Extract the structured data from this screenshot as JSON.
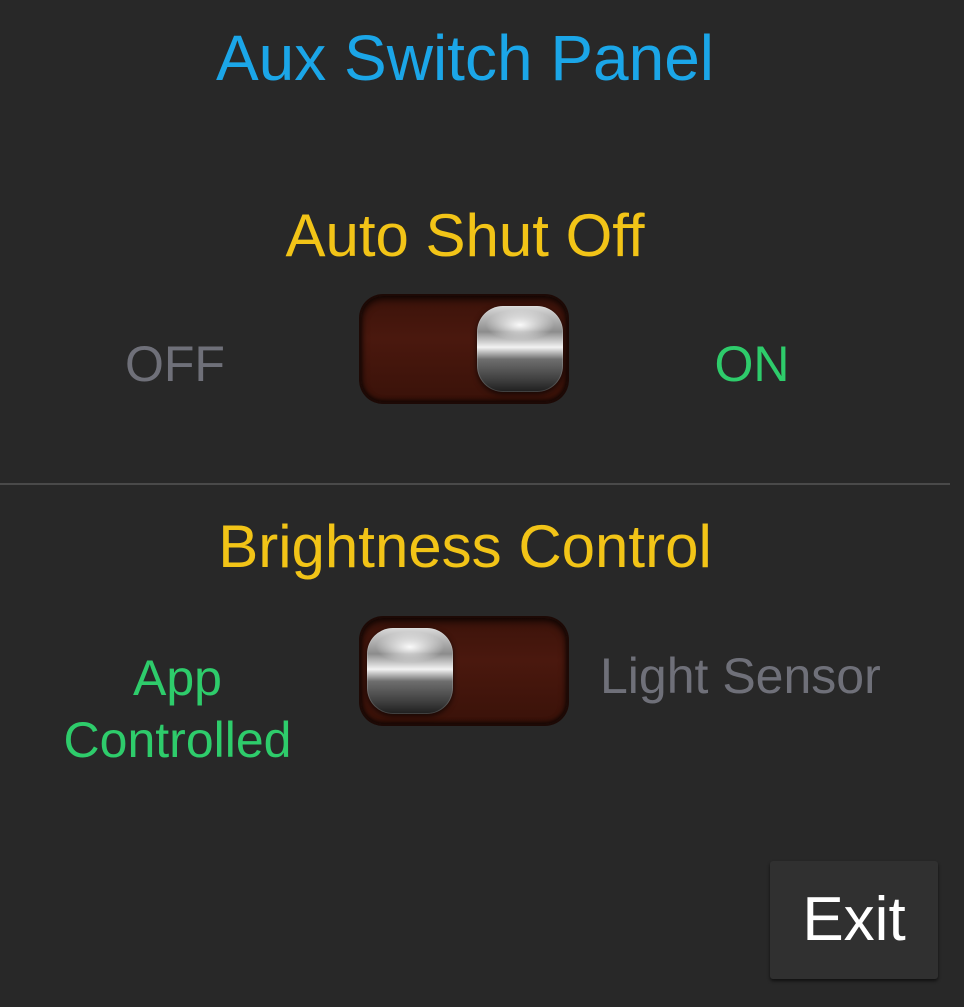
{
  "panel": {
    "title": "Aux Switch Panel",
    "accent_color": "#1ba6e8"
  },
  "auto_shut_off": {
    "title": "Auto Shut Off",
    "off_label": "OFF",
    "on_label": "ON",
    "state": "on"
  },
  "brightness_control": {
    "title": "Brightness Control",
    "left_label_line1": "App",
    "left_label_line2": "Controlled",
    "right_label": "Light Sensor",
    "state": "app-controlled"
  },
  "colors": {
    "section_title": "#f2c417",
    "active_label": "#2ecc6b",
    "inactive_label": "#6f7079",
    "background": "#282828"
  },
  "exit_button": {
    "label": "Exit"
  }
}
